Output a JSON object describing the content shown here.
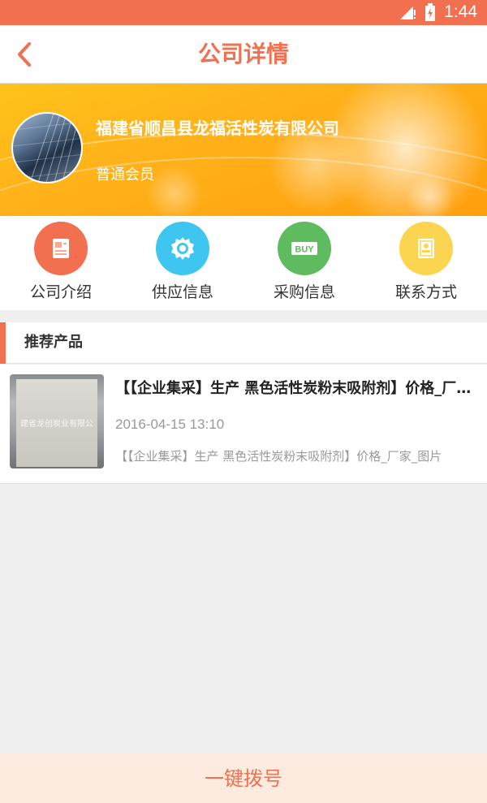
{
  "status_bar": {
    "time": "1:44"
  },
  "header": {
    "title": "公司详情"
  },
  "company": {
    "name": "福建省顺昌县龙福活性炭有限公司",
    "member_level": "普通会员"
  },
  "nav": {
    "items": [
      {
        "label": "公司介绍",
        "icon": "document-icon",
        "color": "#f26f4f"
      },
      {
        "label": "供应信息",
        "icon": "badge-icon",
        "color": "#3fc6f0"
      },
      {
        "label": "采购信息",
        "icon": "buy-icon",
        "color": "#5fbb5f",
        "icon_text": "BUY"
      },
      {
        "label": "联系方式",
        "icon": "contact-card-icon",
        "color": "#fbd54f"
      }
    ]
  },
  "section": {
    "title": "推荐产品"
  },
  "products": [
    {
      "title": "【【企业集采】生产 黑色活性炭粉末吸附剂】价格_厂家_...",
      "date": "2016-04-15 13:10",
      "description": "【【企业集采】生产 黑色活性炭粉末吸附剂】价格_厂家_图片",
      "thumb_text": "建省龙创炭业有限公"
    }
  ],
  "footer": {
    "call_label": "一键拨号"
  },
  "colors": {
    "accent": "#f26f4f",
    "banner": "#ffb21a"
  }
}
